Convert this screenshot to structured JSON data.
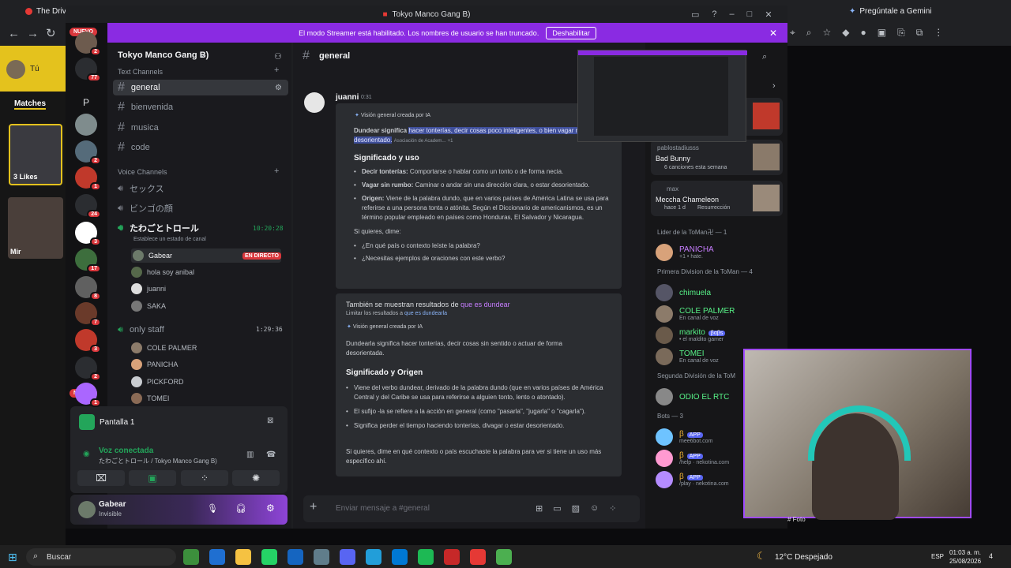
{
  "browser": {
    "tab_left": "The Drive",
    "tab_right": "Pregúntale a Gemini"
  },
  "dating": {
    "user": "Tú",
    "matches": "Matches",
    "likes": "3 Likes",
    "second_name": "Mir"
  },
  "window": {
    "title": "Tokyo Manco Gang B)"
  },
  "banner": {
    "text": "El modo Streamer está habilitado. Los nombres de usuario se han truncado.",
    "button": "Deshabilitar"
  },
  "servers": {
    "new_top": "NUEVO",
    "new_bottom": "NUEVO",
    "badges": [
      "2",
      "77",
      "2",
      "1",
      "24",
      "3",
      "17",
      "8",
      "7",
      "3",
      "2",
      "1"
    ],
    "letter": "P"
  },
  "guild": {
    "name": "Tokyo Manco Gang B)"
  },
  "text_channels": {
    "header": "Text Channels",
    "items": [
      "general",
      "bienvenida",
      "musica",
      "code"
    ]
  },
  "voice_channels": {
    "header": "Voice Channels",
    "items": [
      "セックス",
      "ビンゴの顔",
      "たわごとトロール"
    ],
    "active_time": "10:20:28",
    "status_hint": "Establece un estado de canal",
    "users": [
      "Gabear",
      "hola soy anibal",
      "juanni",
      "SAKA"
    ],
    "live": "EN DIRECTO",
    "staff_channel": "only staff",
    "staff_time": "1:29:36",
    "staff_users": [
      "COLE PALMER",
      "PANICHA",
      "PICKFORD",
      "TOMEI"
    ]
  },
  "stream": {
    "title": "Pantalla 1",
    "voice_status": "Voz conectada",
    "voice_channel": "たわごとトロール / Tokyo Manco Gang B)"
  },
  "user_panel": {
    "name": "Gabear",
    "status": "Invisible"
  },
  "chat": {
    "channel": "general",
    "author": "juanni",
    "time": "0:31",
    "placeholder": "Enviar mensaje a #general",
    "ai1": {
      "label": "Visión general creada por IA",
      "intro": "Dundear significa",
      "highlight": "hacer tonterías, decir cosas poco inteligentes, o bien vagar rumbo y estar desorientado.",
      "source": "Asociación de Academ...",
      "src_count": "+1",
      "heading": "Significado y uso",
      "bullets": [
        [
          "Decir tonterías:",
          "Comportarse o hablar como un tonto o de forma necia."
        ],
        [
          "Vagar sin rumbo:",
          "Caminar o andar sin una dirección clara, o estar desorientado."
        ],
        [
          "Origen:",
          "Viene de la palabra dundo, que en varios países de América Latina se usa para referirse a una persona tonta o atónita. Según el Diccionario de americanismos, es un término popular empleado en países como Honduras, El Salvador y Nicaragua."
        ]
      ],
      "ask": "Si quieres, dime:",
      "asks": [
        "¿En qué país o contexto leíste la palabra?",
        "¿Necesitas ejemplos de oraciones con este verbo?"
      ]
    },
    "ai2": {
      "also": "También se muestran resultados de",
      "also_link": "que es dundear",
      "limit": "Limitar los resultados a",
      "limit_link": "que es dundearla",
      "label": "Visión general creada por IA",
      "intro": "Dundearla significa hacer tonterías, decir cosas sin sentido o actuar de forma desorientada.",
      "heading": "Significado y Origen",
      "bullets": [
        "Viene del verbo dundear, derivado de la palabra dundo (que en varios países de América Central y del Caribe se usa para referirse a alguien tonto, lento o atontado).",
        "El sufijo -la se refiere a la acción en general (como \"pasarla\", \"jugarla\" o \"cagarla\").",
        "Significa perder el tiempo haciendo tonterías, divagar o estar desorientado."
      ],
      "outro": "Si quieres, dime en qué contexto o país escuchaste la palabra para ver si tiene un uso más específico ahí."
    }
  },
  "activity": [
    {
      "user": "pablostadiusss",
      "title": "Bad Bunny",
      "sub": "6 canciones esta semana"
    },
    {
      "user": "max",
      "title": "Meccha Chameleon",
      "sub": "hace 1 d",
      "sub2": "Resurrección"
    }
  ],
  "members": {
    "groups": [
      {
        "title": "Lider de la ToMan卍 — 1",
        "items": [
          {
            "name": "PANICHA",
            "sub": "+1 • hate.",
            "color": "#c77dff"
          }
        ]
      },
      {
        "title": "Primera Division de la ToMan — 4",
        "items": [
          {
            "name": "chimuela",
            "sub": "",
            "color": "#57f287"
          },
          {
            "name": "COLE PALMER",
            "sub": "En canal de voz",
            "color": "#57f287"
          },
          {
            "name": "markito",
            "sub": "• el malditо gamer",
            "color": "#57f287",
            "tag": "βαβs"
          },
          {
            "name": "TOMEI",
            "sub": "En canal de voz",
            "color": "#57f287"
          }
        ]
      },
      {
        "title": "Segunda División de la ToM",
        "items": [
          {
            "name": "ODIO EL RTC",
            "sub": "",
            "color": "#57f287"
          }
        ]
      },
      {
        "title": "Bots — 3",
        "items": [
          {
            "name": "β",
            "sub": "mee6bot.com",
            "color": "#f0b232",
            "tag": "APP"
          },
          {
            "name": "β",
            "sub": "/help · nekotina.com",
            "color": "#f0b232",
            "tag": "APP"
          },
          {
            "name": "β",
            "sub": "/play · nekotina.com",
            "color": "#f0b232",
            "tag": "APP"
          }
        ]
      }
    ]
  },
  "webcam": {
    "caption": "# Foto"
  },
  "taskbar": {
    "search": "Buscar",
    "weather": "12°C  Despejado",
    "lang": "ESP",
    "time": "01:03 a. m.",
    "date": "25/08/2026",
    "notif": "4"
  }
}
